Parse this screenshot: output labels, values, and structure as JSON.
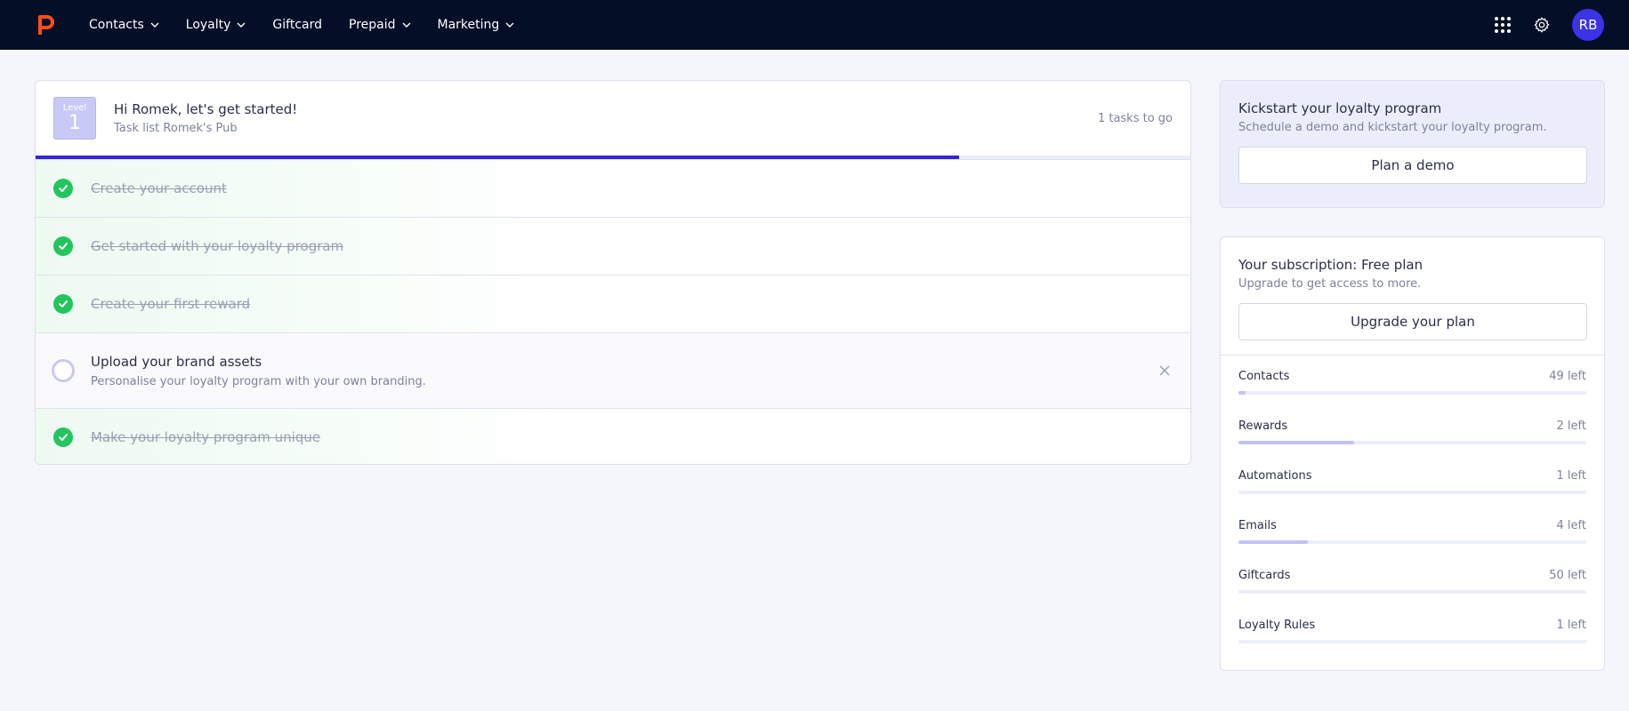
{
  "nav": {
    "items": [
      {
        "label": "Contacts",
        "dropdown": true,
        "icon": "chevron-down-icon"
      },
      {
        "label": "Loyalty",
        "dropdown": true,
        "icon": "chevron-down-icon"
      },
      {
        "label": "Giftcard",
        "dropdown": false
      },
      {
        "label": "Prepaid",
        "dropdown": true,
        "icon": "chevron-down-icon"
      },
      {
        "label": "Marketing",
        "dropdown": true,
        "icon": "chevron-down-icon"
      }
    ],
    "avatar_initials": "RB",
    "icons": [
      "logo-icon",
      "apps-grid-icon",
      "gear-icon"
    ]
  },
  "colors": {
    "topbar": "#050e27",
    "brand_logo": "#ff4d17",
    "accent": "#3128d8",
    "avatar": "#3a33e8",
    "done_check": "#22c55e",
    "level_badge": "#c9c9f7"
  },
  "tasks_card": {
    "level_label": "Level",
    "level_number": "1",
    "greeting": "Hi Romek, let's get started!",
    "subtitle": "Task list Romek's Pub",
    "tasks_to_go": "1 tasks to go",
    "progress_fraction": 0.8,
    "tasks": [
      {
        "title": "Create your account",
        "done": true
      },
      {
        "title": "Get started with your loyalty program",
        "done": true
      },
      {
        "title": "Create your first reward",
        "done": true
      },
      {
        "title": "Upload your brand assets",
        "done": false,
        "description": "Personalise your loyalty program with your own branding."
      },
      {
        "title": "Make your loyalty program unique",
        "done": true
      }
    ]
  },
  "demo_card": {
    "title": "Kickstart your loyalty program",
    "subtitle": "Schedule a demo and kickstart your loyalty program.",
    "button_label": "Plan a demo"
  },
  "subscription_card": {
    "title": "Your subscription: Free plan",
    "subtitle": "Upgrade to get access to more.",
    "button_label": "Upgrade your plan",
    "usage": [
      {
        "name": "Contacts",
        "left": "49 left",
        "used_fraction": 0.02
      },
      {
        "name": "Rewards",
        "left": "2 left",
        "used_fraction": 0.333
      },
      {
        "name": "Automations",
        "left": "1 left",
        "used_fraction": 0.0
      },
      {
        "name": "Emails",
        "left": "4 left",
        "used_fraction": 0.2
      },
      {
        "name": "Giftcards",
        "left": "50 left",
        "used_fraction": 0.0
      },
      {
        "name": "Loyalty Rules",
        "left": "1 left",
        "used_fraction": 0.0
      }
    ]
  }
}
